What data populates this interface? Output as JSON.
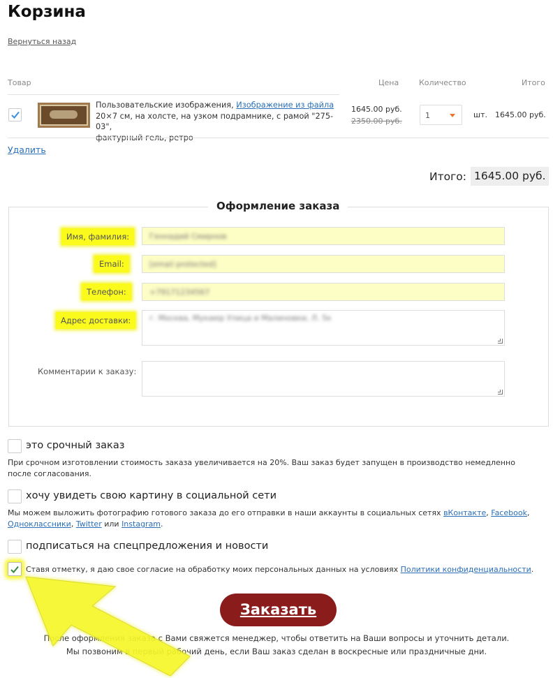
{
  "page": {
    "title": "Корзина",
    "back_link": "Вернуться назад"
  },
  "cart": {
    "headers": {
      "product": "Товар",
      "price": "Цена",
      "quantity": "Количество",
      "total": "Итого"
    },
    "item": {
      "checked": true,
      "description_prefix": "Пользовательские изображения,",
      "description_link": "Изображение из файла",
      "description_line2": "20×7 см, на холсте, на узком подрамнике, с рамой \"275-03\",",
      "description_line3": "фактурный гель, ретро",
      "price": "1645.00 руб.",
      "old_price": "2350.00 руб.",
      "quantity": "1",
      "unit": "шт.",
      "total": "1645.00 руб."
    },
    "delete_link": "Удалить",
    "grand_total_label": "Итого:",
    "grand_total_value": "1645.00 руб."
  },
  "order_form": {
    "legend": "Оформление заказа",
    "name_label": "Имя, фамилия:",
    "name_value": "Геннадий Смирнов",
    "email_label": "Email:",
    "email_value": "[email protected]",
    "phone_label": "Телефон:",
    "phone_value": "+79171234567",
    "address_label": "Адрес доставки:",
    "address_value": "г. Москва, Мукаюр Улица и Малиновки, Л. 5к",
    "comment_label": "Комментарии к заказу:",
    "comment_value": ""
  },
  "options": {
    "urgent_label": "это срочный заказ",
    "urgent_note": "При срочном изготовлении стоимость заказа увеличивается на 20%. Ваш заказ будет запущен в производство немедленно после согласования.",
    "social_label": "хочу увидеть свою картину в социальной сети",
    "social_note_prefix": "Мы можем выложить фотографию готового заказа до его отправки в наши аккаунты в социальных сетях",
    "social_links": [
      "вКонтакте",
      "Facebook",
      "Одноклассники",
      "Twitter",
      "Instagram"
    ],
    "social_or": "или",
    "subscribe_label": "подписаться на спецпредложения и новости",
    "consent_text": "Ставя отметку, я даю свое согласие на обработку моих персональных данных на условиях",
    "consent_link": "Политики конфиденциальности",
    "consent_checked": true
  },
  "submit": {
    "label": "Заказать"
  },
  "after_order": {
    "line1": "После оформления заказа с Вами свяжется менеджер, чтобы ответить на Ваши вопросы и уточнить детали.",
    "line2": "Мы позвоним в первый рабочий день, если Ваш заказ сделан в воскресные или праздничные дни."
  },
  "colors": {
    "highlight": "#fafa1d",
    "button": "#8b1c1c",
    "link": "#2a6fb8",
    "accent_arrow": "#e8792b",
    "annotation_arrow": "#f7f72a"
  }
}
